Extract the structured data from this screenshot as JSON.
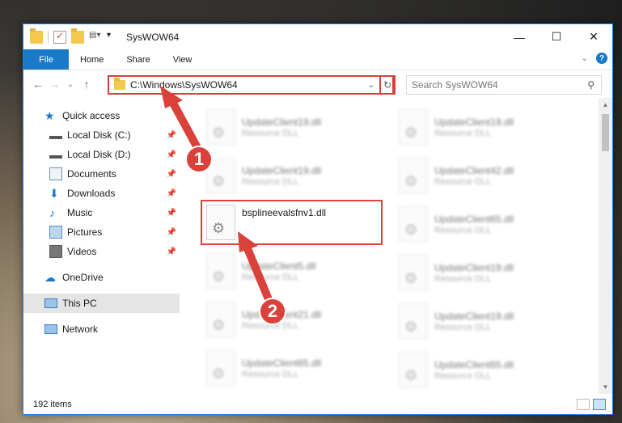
{
  "window": {
    "title": "SysWOW64",
    "controls": {
      "minimize": "—",
      "maximize": "☐",
      "close": "✕"
    }
  },
  "ribbon": {
    "file": "File",
    "tabs": [
      "Home",
      "Share",
      "View"
    ],
    "help": "?"
  },
  "address": {
    "path": "C:\\Windows\\SysWOW64",
    "search_placeholder": "Search SysWOW64"
  },
  "sidebar": {
    "quick_access": "Quick access",
    "items": [
      {
        "label": "Local Disk (C:)",
        "icon": "drive-icon"
      },
      {
        "label": "Local Disk (D:)",
        "icon": "drive-icon"
      },
      {
        "label": "Documents",
        "icon": "documents-icon"
      },
      {
        "label": "Downloads",
        "icon": "downloads-icon"
      },
      {
        "label": "Music",
        "icon": "music-icon"
      },
      {
        "label": "Pictures",
        "icon": "pictures-icon"
      },
      {
        "label": "Videos",
        "icon": "videos-icon"
      }
    ],
    "onedrive": "OneDrive",
    "this_pc": "This PC",
    "network": "Network"
  },
  "files": {
    "col1": [
      {
        "name": "UpdateClient19.dll",
        "type": "Resource DLL"
      },
      {
        "name": "UpdateClient19.dll",
        "type": "Resource DLL"
      },
      {
        "name": "bsplineevalsfnv1.dll",
        "type": ""
      },
      {
        "name": "UpdateClient5.dll",
        "type": "Resource DLL"
      },
      {
        "name": "UpdateClient21.dll",
        "type": "Resource DLL"
      },
      {
        "name": "UpdateClient65.dll",
        "type": "Resource DLL"
      }
    ],
    "col2": [
      {
        "name": "UpdateClient19.dll",
        "type": "Resource DLL"
      },
      {
        "name": "UpdateClient42.dll",
        "type": "Resource DLL"
      },
      {
        "name": "UpdateClient65.dll",
        "type": "Resource DLL"
      },
      {
        "name": "UpdateClient19.dll",
        "type": "Resource DLL"
      },
      {
        "name": "UpdateClient19.dll",
        "type": "Resource DLL"
      },
      {
        "name": "UpdateClient65.dll",
        "type": "Resource DLL"
      }
    ]
  },
  "status": {
    "count": "192 items"
  },
  "annotations": {
    "step1": "1",
    "step2": "2"
  },
  "colors": {
    "accent": "#1979ca",
    "annotation": "#d9413a"
  }
}
